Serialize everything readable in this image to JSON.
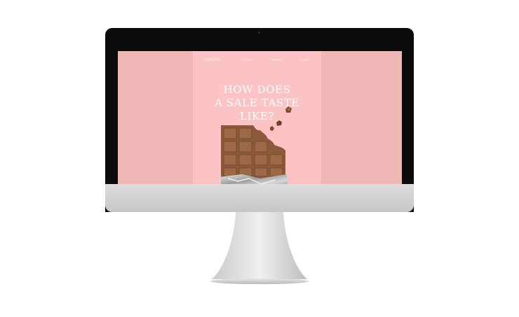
{
  "site": {
    "logo": "CHOCO",
    "nav": [
      "STORE",
      "TASTE",
      "SHOP"
    ],
    "headline": [
      "HOW DOES",
      "A SALE TASTE",
      "LIKE?"
    ]
  },
  "colors": {
    "screen_bg": "#efb8b6",
    "site_bg": "#fbc3c3",
    "bezel": "#0b0b0b",
    "chocolate": "#8b5a3c",
    "foil": "#bdbdbd",
    "text": "#ffffff"
  },
  "icons": {
    "chocolate": "chocolate-bar-illustration",
    "crumbs": "chocolate-crumbs"
  }
}
